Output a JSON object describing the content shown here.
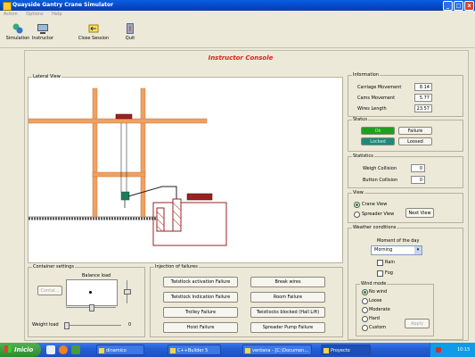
{
  "window": {
    "title": "Quayside Gantry Crane Simulator",
    "min_label": "_",
    "max_label": "□",
    "close_label": "x"
  },
  "menu": [
    "Action",
    "Options",
    "Help"
  ],
  "toolbar": [
    {
      "label": "Simulation",
      "icon": "simulation-icon"
    },
    {
      "label": "Instructor",
      "icon": "instructor-icon"
    },
    {
      "label": "Close Session",
      "icon": "close-session-icon"
    },
    {
      "label": "Quit",
      "icon": "quit-icon"
    }
  ],
  "console_title": "Instructor Console",
  "lateral_view": {
    "label": "Lateral View"
  },
  "information": {
    "label": "Information",
    "rows": [
      {
        "label": "Carriage Movement",
        "value": "8.14"
      },
      {
        "label": "Cams Movement",
        "value": "5.77"
      },
      {
        "label": "Wires Length",
        "value": "23.57"
      }
    ]
  },
  "status": {
    "label": "Status",
    "ok": "Ok",
    "failure": "Failure",
    "locked": "Locked",
    "loosed": "Loosed",
    "colors": {
      "ok": "#1f9e1f",
      "locked": "#1c8a7c"
    }
  },
  "statistics": {
    "label": "Statistics",
    "rows": [
      {
        "label": "Weigh Collision",
        "value": "0"
      },
      {
        "label": "Button Collision",
        "value": "0"
      }
    ]
  },
  "view": {
    "label": "View",
    "options": [
      "Crane View",
      "Spreader View"
    ],
    "selected": "Crane View",
    "next_button": "Next View"
  },
  "weather": {
    "label": "Weather conditions",
    "moment_label": "Moment of the day",
    "moment_value": "Morning",
    "rain": "Rain",
    "fog": "Fog",
    "wind_label": "Wind mode",
    "wind_options": [
      "No wind",
      "Loose",
      "Moderate",
      "Hard",
      "Custom"
    ],
    "wind_selected": "No wind",
    "apply_button": "Apply"
  },
  "container_settings": {
    "label": "Container settings",
    "button": "Contai...",
    "balance_label": "Balance load",
    "weight_label": "Weight load",
    "weight_value": "0"
  },
  "injection": {
    "label": "Injection of failures",
    "buttons": [
      "Twistlock activation Failure",
      "Break wires",
      "Twistlock Indication Failure",
      "Room Failure",
      "Trolley Failure",
      "Twistlocks blocked (Hall Lift)",
      "Hoist Failure",
      "Spreader Pump Failure"
    ]
  },
  "taskbar": {
    "start": "Inicio",
    "tasks": [
      "dinamico",
      "C++Builder 5",
      "ventana - [C:\\Documen...",
      "Proyecto"
    ],
    "clock": "10:15"
  }
}
